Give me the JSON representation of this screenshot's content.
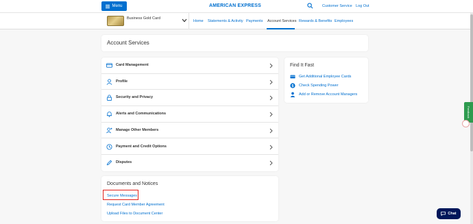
{
  "header": {
    "menu_label": "Menu",
    "brand": "AMERICAN EXPRESS",
    "customer_service": "Customer Service",
    "log_out": "Log Out"
  },
  "card_selector": {
    "card_name": "Business Gold Card"
  },
  "nav": {
    "tabs": [
      {
        "label": "Home"
      },
      {
        "label": "Statements & Activity"
      },
      {
        "label": "Payments"
      },
      {
        "label": "Account Services",
        "active": true
      },
      {
        "label": "Rewards & Benefits"
      },
      {
        "label": "Employees"
      }
    ]
  },
  "main": {
    "title": "Account Services",
    "services": [
      {
        "label": "Card Management",
        "icon": "card-icon"
      },
      {
        "label": "Profile",
        "icon": "user-icon"
      },
      {
        "label": "Security and Privacy",
        "icon": "lock-icon"
      },
      {
        "label": "Alerts and Communications",
        "icon": "bell-icon"
      },
      {
        "label": "Manage Other Members",
        "icon": "members-icon"
      },
      {
        "label": "Payment and Credit Options",
        "icon": "clock-icon"
      },
      {
        "label": "Disputes",
        "icon": "pen-icon"
      }
    ]
  },
  "find_it_fast": {
    "title": "Find It Fast",
    "links": [
      {
        "label": "Get Additional Employee Cards",
        "icon": "card-icon"
      },
      {
        "label": "Check Spending Power",
        "icon": "dollar-icon"
      },
      {
        "label": "Add or Remove Account Managers",
        "icon": "user-icon"
      }
    ]
  },
  "documents": {
    "title": "Documents and Notices",
    "links": [
      {
        "label": "Secure Messages"
      },
      {
        "label": "Request Card Member Agreement"
      },
      {
        "label": "Upload Files to Document Center"
      }
    ]
  },
  "feedback_label": "Feedback",
  "chat_label": "Chat",
  "colors": {
    "brand_blue": "#006fcf",
    "chat_navy": "#00175a",
    "highlight_red": "#e0201b",
    "feedback_green": "#2e9b4f"
  }
}
